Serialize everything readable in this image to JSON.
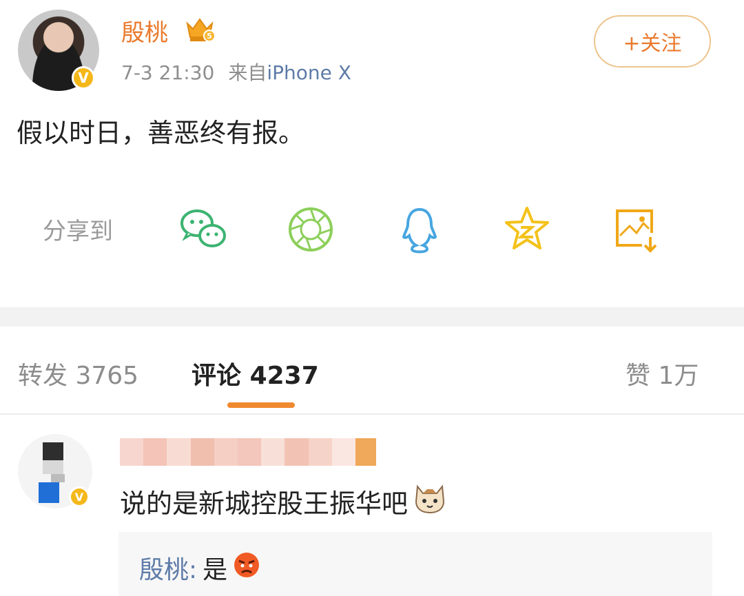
{
  "post": {
    "username": "殷桃",
    "level_badge": "crown-level-5-icon",
    "time": "7-3 21:30",
    "source_prefix": "来自",
    "source_device": "iPhone X",
    "follow_label": "+关注",
    "content": "假以时日，善恶终有报。",
    "verified_badge": "V"
  },
  "share": {
    "label": "分享到",
    "targets": [
      "wechat-icon",
      "moments-icon",
      "qq-icon",
      "qzone-icon",
      "save-image-icon"
    ]
  },
  "tabs": {
    "repost_label": "转发",
    "repost_count": "3765",
    "comment_label": "评论",
    "comment_count": "4237",
    "like_label": "赞",
    "like_count": "1万"
  },
  "comment": {
    "text": "说的是新城控股王振华吧",
    "emoji": "cat-face-icon",
    "reply_name": "殷桃:",
    "reply_text": "是",
    "reply_emoji": "angry-face-icon"
  },
  "colors": {
    "accent": "#ea7a2d",
    "link": "#5e7ca8",
    "wechat": "#3cb371",
    "moments": "#8ccf5a",
    "qq": "#46a6e0",
    "qzone": "#f3c21a",
    "save": "#f0a818"
  }
}
